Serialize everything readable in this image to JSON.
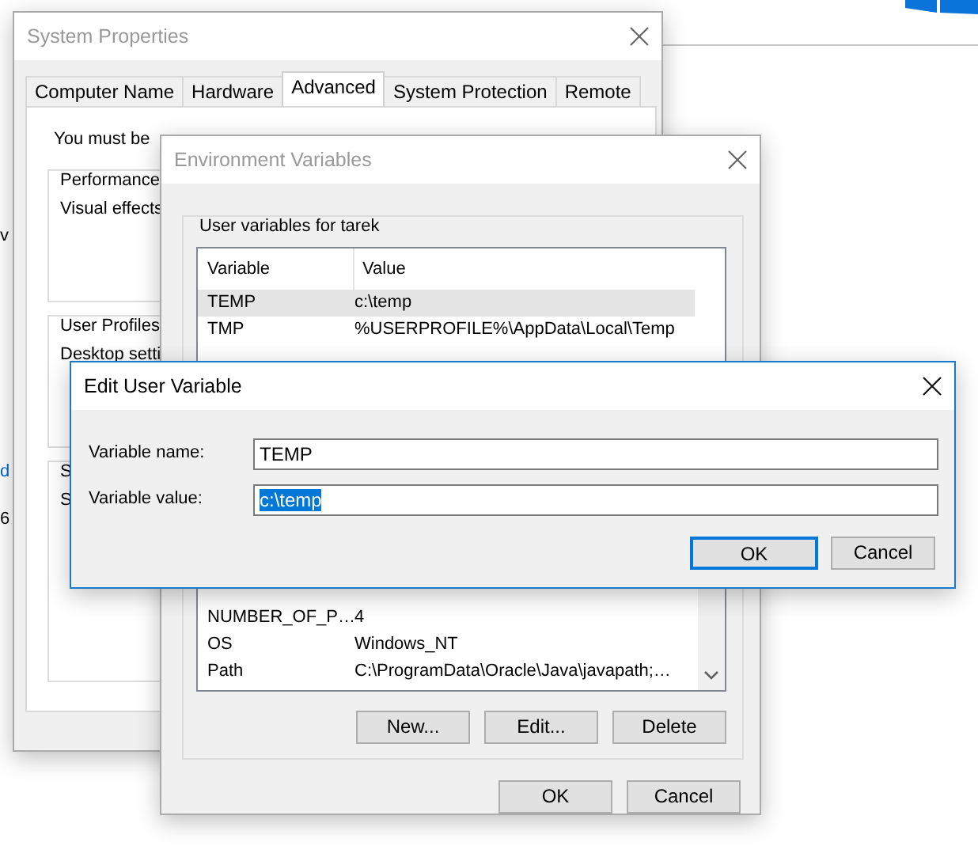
{
  "desktop": {
    "background_texts": [
      {
        "text": "v",
        "kind": "plain"
      },
      {
        "text": "d",
        "kind": "link"
      },
      {
        "text": "6",
        "kind": "plain"
      }
    ]
  },
  "system_properties": {
    "title": "System Properties",
    "tabs": [
      {
        "label": "Computer Name",
        "selected": false
      },
      {
        "label": "Hardware",
        "selected": false
      },
      {
        "label": "Advanced",
        "selected": true
      },
      {
        "label": "System Protection",
        "selected": false
      },
      {
        "label": "Remote",
        "selected": false
      }
    ],
    "notice": "You must be",
    "groups": [
      {
        "label": "Performance",
        "text": "Visual effects"
      },
      {
        "label": "User Profiles",
        "text": "Desktop setti"
      },
      {
        "label": "S",
        "text": "S"
      }
    ]
  },
  "environment_variables": {
    "title": "Environment Variables",
    "user_variables": {
      "label": "User variables for tarek",
      "columns": [
        "Variable",
        "Value"
      ],
      "rows": [
        {
          "variable": "TEMP",
          "value": "c:\\temp",
          "selected": true
        },
        {
          "variable": "TMP",
          "value": "%USERPROFILE%\\AppData\\Local\\Temp",
          "selected": false
        }
      ]
    },
    "system_variables": {
      "rows": [
        {
          "variable": "NUMBER_OF_P…",
          "value": "4",
          "selected": false
        },
        {
          "variable": "OS",
          "value": "Windows_NT",
          "selected": false
        },
        {
          "variable": "Path",
          "value": "C:\\ProgramData\\Oracle\\Java\\javapath;…",
          "selected": false
        }
      ]
    },
    "list_buttons": [
      "New...",
      "Edit...",
      "Delete"
    ],
    "buttons": [
      "OK",
      "Cancel"
    ]
  },
  "edit_dialog": {
    "title": "Edit User Variable",
    "fields": [
      {
        "label": "Variable name:",
        "value": "TEMP",
        "text_selected": false
      },
      {
        "label": "Variable value:",
        "value": "c:\\temp",
        "text_selected": true
      }
    ],
    "buttons": [
      {
        "label": "OK",
        "default": true
      },
      {
        "label": "Cancel",
        "default": false
      }
    ]
  }
}
